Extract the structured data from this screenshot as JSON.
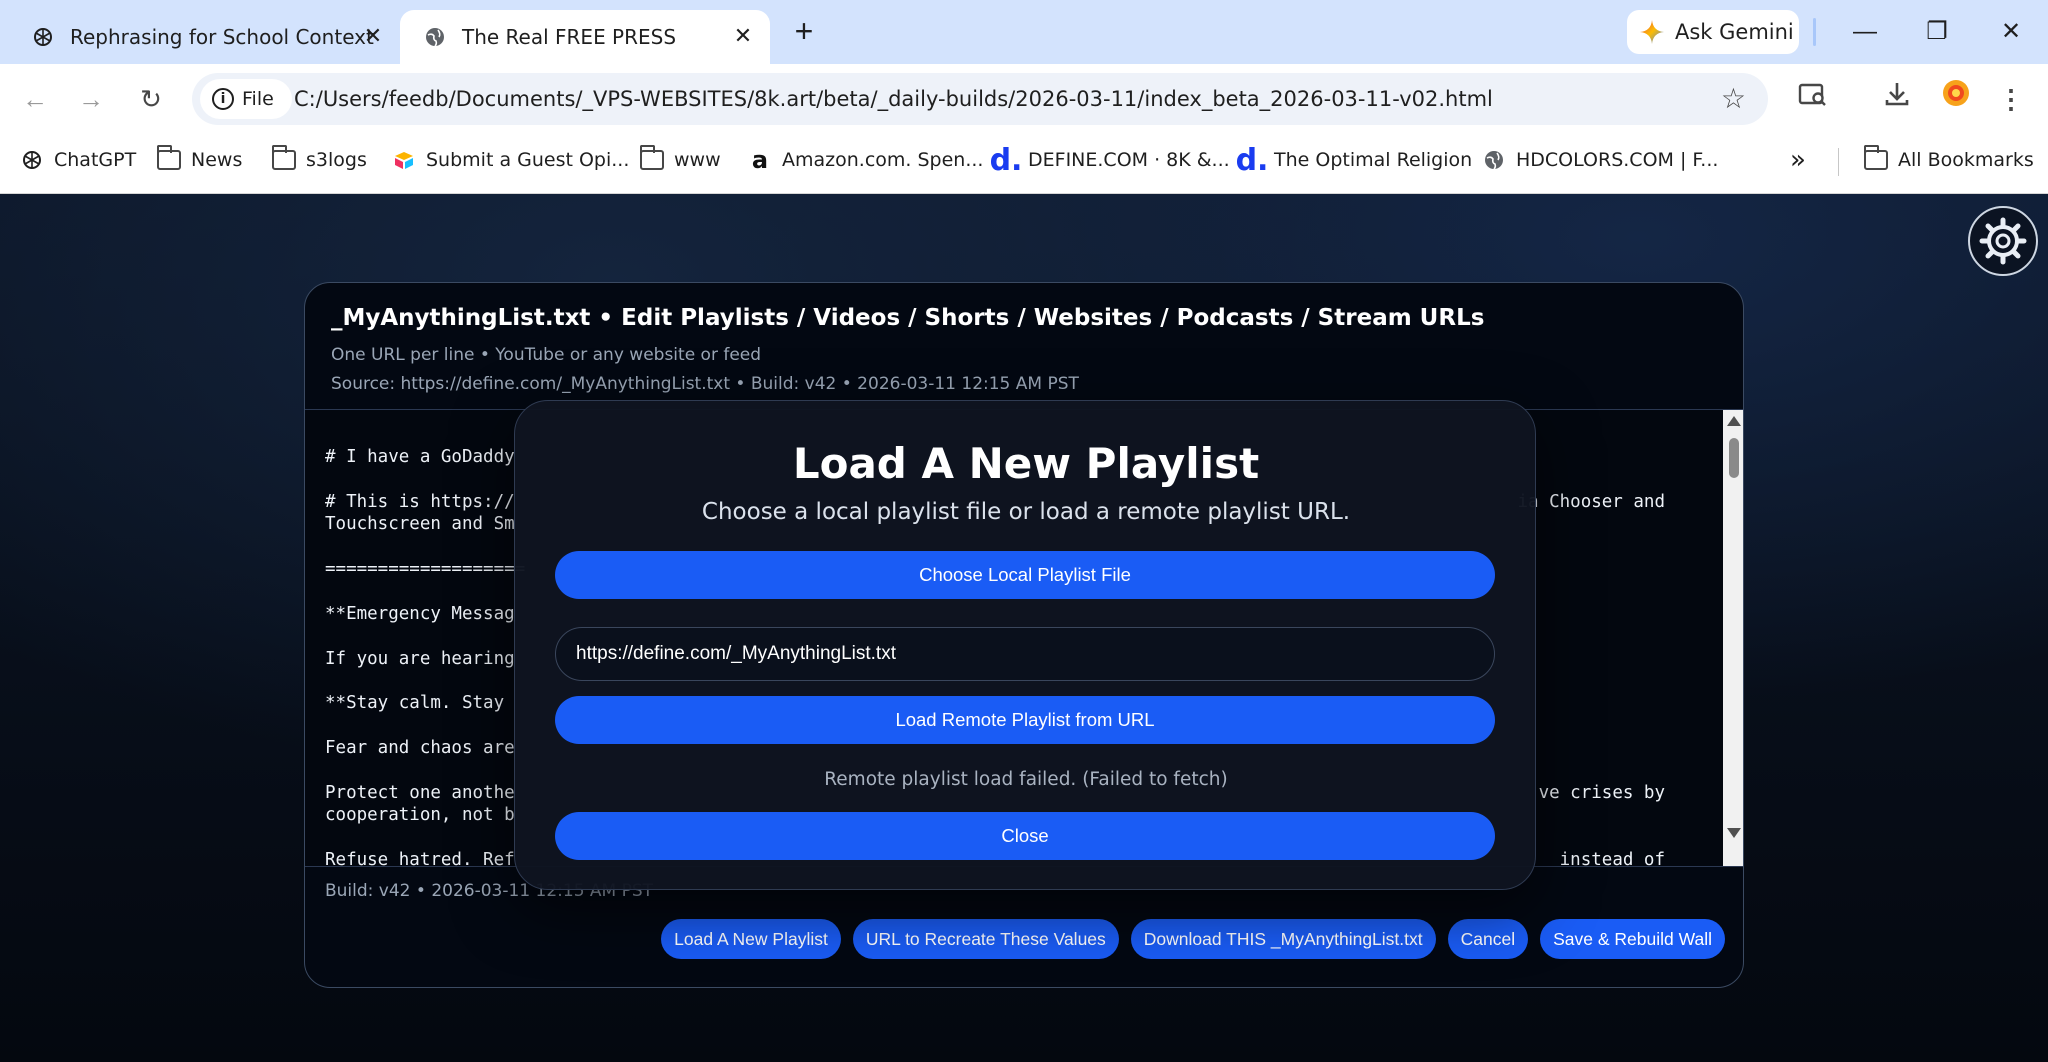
{
  "browser": {
    "tabs": [
      {
        "title": "Rephrasing for School Context",
        "icon": "openai-icon",
        "active": false
      },
      {
        "title": "The Real FREE PRESS",
        "icon": "globe-icon",
        "active": true
      }
    ],
    "gemini_label": "Ask Gemini",
    "scheme_label": "File",
    "url": "C:/Users/feedb/Documents/_VPS-WEBSITES/8k.art/beta/_daily-builds/2026-03-11/index_beta_2026-03-11-v02.html",
    "bookmarks": [
      {
        "label": "ChatGPT",
        "icon": "openai-icon"
      },
      {
        "label": "News",
        "icon": "folder-icon"
      },
      {
        "label": "s3logs",
        "icon": "folder-icon"
      },
      {
        "label": "Submit a Guest Opi...",
        "icon": "airtable-icon"
      },
      {
        "label": "www",
        "icon": "folder-icon"
      },
      {
        "label": "Amazon.com. Spen...",
        "icon": "amazon-icon"
      },
      {
        "label": "DEFINE.COM · 8K &...",
        "icon": "define-icon"
      },
      {
        "label": "The Optimal Religion",
        "icon": "define-icon"
      },
      {
        "label": "HDCOLORS.COM | F...",
        "icon": "globe-icon"
      }
    ],
    "overflow_label": "»",
    "all_bookmarks_label": "All Bookmarks"
  },
  "editor": {
    "title": "_MyAnythingList.txt • Edit Playlists / Videos / Shorts / Websites / Podcasts / Stream URLs",
    "subtitle": "One URL per line • YouTube or any website or feed",
    "source": "Source: https://define.com/_MyAnythingList.txt • Build: v42 • 2026-03-11 12:15 AM PST",
    "lines": [
      {
        "left": "# I have a GoDaddy",
        "right": ""
      },
      {
        "left": "",
        "right": ""
      },
      {
        "left": "# This is https://",
        "right": "ia Chooser and"
      },
      {
        "left": "Touchscreen and Sm",
        "right": ""
      },
      {
        "left": "",
        "right": ""
      },
      {
        "left": "===================",
        "right": ""
      },
      {
        "left": "",
        "right": ""
      },
      {
        "left": "**Emergency Messag",
        "right": ""
      },
      {
        "left": "",
        "right": ""
      },
      {
        "left": "If you are hearing",
        "right": ""
      },
      {
        "left": "",
        "right": ""
      },
      {
        "left": "**Stay calm. Stay",
        "right": ""
      },
      {
        "left": "",
        "right": ""
      },
      {
        "left": "Fear and chaos are",
        "right": ""
      },
      {
        "left": "",
        "right": ""
      },
      {
        "left": "Protect one anothe",
        "right": "ve crises by"
      },
      {
        "left": "cooperation, not b",
        "right": ""
      },
      {
        "left": "",
        "right": ""
      },
      {
        "left": "Refuse hatred. Ref",
        "right": "instead of"
      }
    ],
    "build": "Build: v42 • 2026-03-11 12:15 AM PST",
    "actions": [
      "Load A New Playlist",
      "URL to Recreate These Values",
      "Download THIS _MyAnythingList.txt",
      "Cancel",
      "Save & Rebuild Wall"
    ]
  },
  "modal": {
    "title": "Load A New Playlist",
    "subtitle": "Choose a local playlist file or load a remote playlist URL.",
    "choose_file_label": "Choose Local Playlist File",
    "url_value": "https://define.com/_MyAnythingList.txt",
    "load_remote_label": "Load Remote Playlist from URL",
    "status": "Remote playlist load failed. (Failed to fetch)",
    "close_label": "Close"
  },
  "colors": {
    "accent": "#1a5cf5",
    "page_bg": "#0a1220",
    "tabstrip_bg": "#d3e3fd"
  }
}
